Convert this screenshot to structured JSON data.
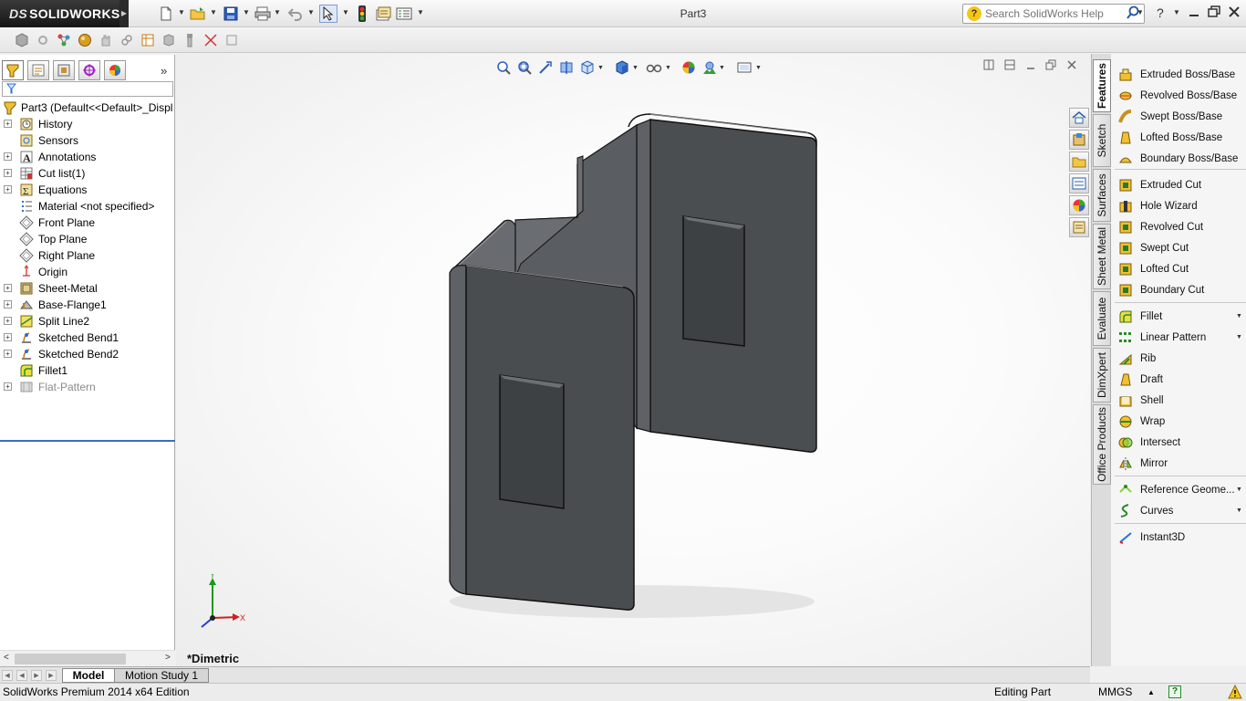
{
  "app": {
    "logo_prefix": "DS",
    "logo_text": "SOLIDWORKS",
    "document_title": "Part3"
  },
  "search": {
    "placeholder": "Search SolidWorks Help",
    "help_glyph": "?"
  },
  "feature_manager": {
    "root_label": "Part3  (Default<<Default>_Displ",
    "items": [
      {
        "label": "History",
        "icon": "history-icon",
        "expandable": true
      },
      {
        "label": "Sensors",
        "icon": "sensors-icon",
        "expandable": false
      },
      {
        "label": "Annotations",
        "icon": "annotations-icon",
        "expandable": true
      },
      {
        "label": "Cut list(1)",
        "icon": "cut-list-icon",
        "expandable": true
      },
      {
        "label": "Equations",
        "icon": "equations-icon",
        "expandable": true
      },
      {
        "label": "Material <not specified>",
        "icon": "material-icon",
        "expandable": false
      },
      {
        "label": "Front Plane",
        "icon": "plane-icon",
        "expandable": false
      },
      {
        "label": "Top Plane",
        "icon": "plane-icon",
        "expandable": false
      },
      {
        "label": "Right Plane",
        "icon": "plane-icon",
        "expandable": false
      },
      {
        "label": "Origin",
        "icon": "origin-icon",
        "expandable": false
      },
      {
        "label": "Sheet-Metal",
        "icon": "sheet-metal-icon",
        "expandable": true
      },
      {
        "label": "Base-Flange1",
        "icon": "base-flange-icon",
        "expandable": true
      },
      {
        "label": "Split Line2",
        "icon": "split-line-icon",
        "expandable": true
      },
      {
        "label": "Sketched Bend1",
        "icon": "sketched-bend-icon",
        "expandable": true
      },
      {
        "label": "Sketched Bend2",
        "icon": "sketched-bend-icon",
        "expandable": true
      },
      {
        "label": "Fillet1",
        "icon": "fillet-icon",
        "expandable": false
      },
      {
        "label": "Flat-Pattern",
        "icon": "flat-pattern-icon",
        "expandable": true,
        "suppressed": true
      }
    ]
  },
  "viewport": {
    "view_name": "*Dimetric",
    "triad": {
      "x": "X",
      "y": "Y"
    }
  },
  "command_tabs": [
    "Features",
    "Sketch",
    "Surfaces",
    "Sheet Metal",
    "Evaluate",
    "DimXpert",
    "Office Products"
  ],
  "commands": {
    "group1": [
      "Extruded Boss/Base",
      "Revolved Boss/Base",
      "Swept Boss/Base",
      "Lofted Boss/Base",
      "Boundary Boss/Base"
    ],
    "group2": [
      "Extruded Cut",
      "Hole Wizard",
      "Revolved Cut",
      "Swept Cut",
      "Lofted Cut",
      "Boundary Cut"
    ],
    "group3": [
      "Fillet",
      "Linear Pattern",
      "Rib",
      "Draft",
      "Shell",
      "Wrap",
      "Intersect",
      "Mirror"
    ],
    "group4": [
      "Reference Geome...",
      "Curves"
    ],
    "group5": [
      "Instant3D"
    ]
  },
  "bottom_tabs": [
    "Model",
    "Motion Study 1"
  ],
  "status": {
    "edition": "SolidWorks Premium 2014 x64 Edition",
    "mode": "Editing Part",
    "units": "MMGS",
    "help_glyph": "?"
  },
  "colors": {
    "model_face": "#4a4d50",
    "accent_blue": "#2357a8",
    "titlebar_dark": "#1e1e1e"
  }
}
